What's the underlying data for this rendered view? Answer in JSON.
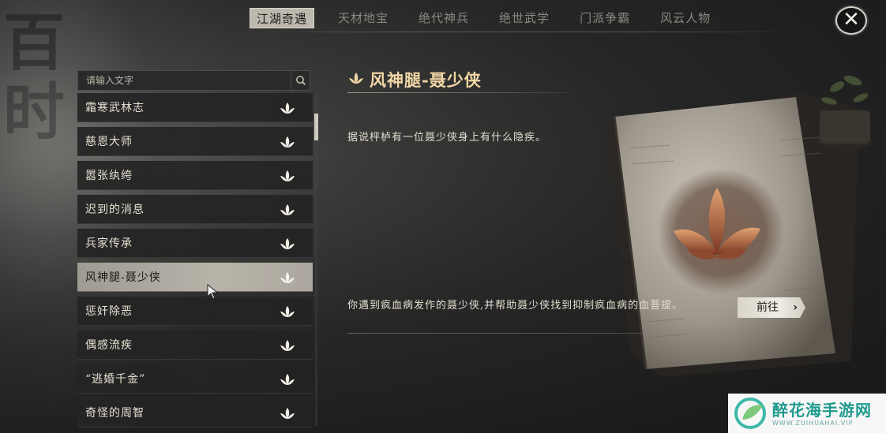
{
  "background_glyphs": [
    "百",
    "时"
  ],
  "top_tabs": [
    {
      "label": "江湖奇遇",
      "active": true
    },
    {
      "label": "天材地宝",
      "active": false
    },
    {
      "label": "绝代神兵",
      "active": false
    },
    {
      "label": "绝世武学",
      "active": false
    },
    {
      "label": "门派争霸",
      "active": false
    },
    {
      "label": "风云人物",
      "active": false
    }
  ],
  "close_icon": "close-icon",
  "search": {
    "placeholder": "请输入文字",
    "icon": "search-icon"
  },
  "quests": [
    {
      "label": "霜寒武林志",
      "selected": false
    },
    {
      "label": "慈恩大师",
      "selected": false
    },
    {
      "label": "嚣张纨绔",
      "selected": false
    },
    {
      "label": "迟到的消息",
      "selected": false
    },
    {
      "label": "兵家传承",
      "selected": false
    },
    {
      "label": "风神腿-聂少侠",
      "selected": true
    },
    {
      "label": "惩奸除恶",
      "selected": false
    },
    {
      "label": "偶感流疾",
      "selected": false
    },
    {
      "label": "“逃婚千金”",
      "selected": false
    },
    {
      "label": "奇怪的周智",
      "selected": false
    }
  ],
  "detail": {
    "title": "风神腿-聂少侠",
    "description": "据说枰栌有一位聂少侠身上有什么隐疾。",
    "task": "你遇到疯血病发作的聂少侠,并帮助聂少侠找到抑制疯血病的血菩提。",
    "goto_label": "前往",
    "goto_arrow": "›"
  },
  "colors": {
    "accent_title": "#f1d7a5",
    "tab_active_bg": "#bdb8ad",
    "selected_item_bg": "#b8b3a9"
  },
  "watermark": {
    "title": "醉花海手游网",
    "subtitle": "WWW.ZUIHUAHAI.VIP"
  }
}
